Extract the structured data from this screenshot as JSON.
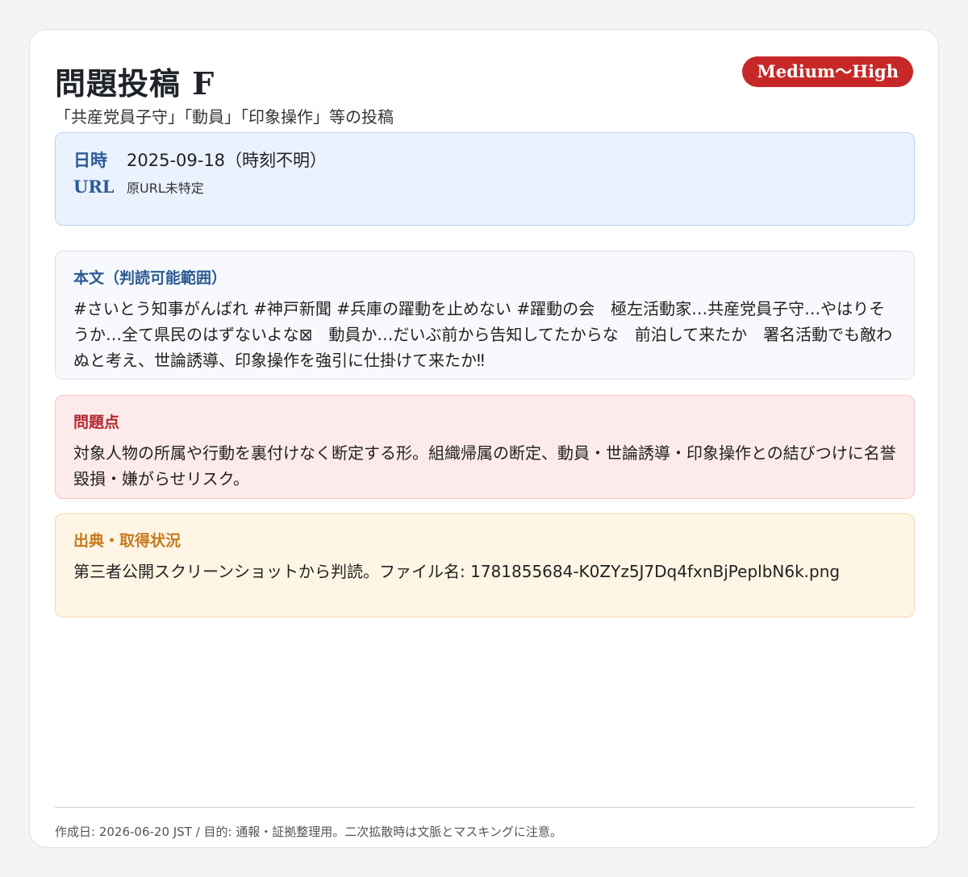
{
  "header": {
    "title": "問題投稿 F",
    "subtitle": "「共産党員子守」「動員」「印象操作」等の投稿",
    "risk_badge": "Medium〜High",
    "risk_color": "#c62828"
  },
  "meta": {
    "date_label": "日時",
    "date_value": "2025-09-18（時刻不明）",
    "url_label": "URL",
    "url_value": "原URL未特定"
  },
  "body": {
    "heading": "本文（判読可能範囲）",
    "text": "#さいとう知事がんばれ #神戸新聞 #兵庫の躍動を止めない #躍動の会　極左活動家…共産党員子守…やはりそうか…全て県民のはずないよな⊠　動員か…だいぶ前から告知してたからな　前泊して来たか　署名活動でも敵わぬと考え、世論誘導、印象操作を強引に仕掛けて来たか‼"
  },
  "problem": {
    "heading": "問題点",
    "text": "対象人物の所属や行動を裏付けなく断定する形。組織帰属の断定、動員・世論誘導・印象操作との結びつけに名誉毀損・嫌がらせリスク。"
  },
  "source": {
    "heading": "出典・取得状況",
    "text": "第三者公開スクリーンショットから判読。ファイル名: 1781855684-K0ZYz5J7Dq4fxnBjPeplbN6k.png"
  },
  "footer": {
    "text": "作成日: 2026-06-20 JST / 目的: 通報・証拠整理用。二次拡散時は文脈とマスキングに注意。"
  }
}
